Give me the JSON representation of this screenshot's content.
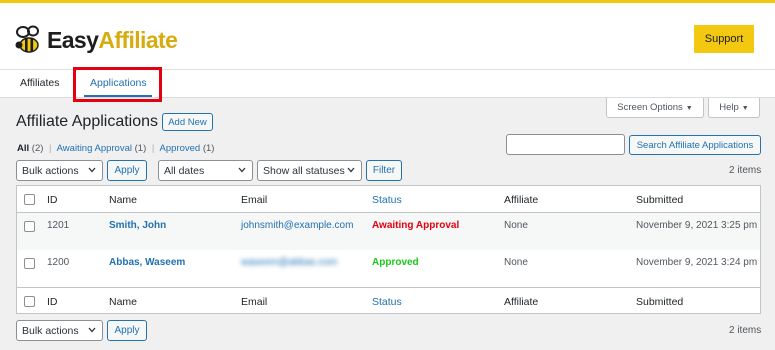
{
  "brand": {
    "logo_word1": "Easy",
    "logo_word2": "Affiliate",
    "support_label": "Support",
    "accent_color": "#f2c811"
  },
  "tabs": {
    "affiliates": "Affiliates",
    "applications": "Applications",
    "active": "applications"
  },
  "screen_options": {
    "screen_options_label": "Screen Options",
    "help_label": "Help"
  },
  "page": {
    "title": "Affiliate Applications",
    "add_new_label": "Add New"
  },
  "filters": {
    "all": {
      "label": "All",
      "count": "(2)"
    },
    "awaiting": {
      "label": "Awaiting Approval",
      "count": "(1)"
    },
    "approved": {
      "label": "Approved",
      "count": "(1)"
    },
    "separator": "|"
  },
  "search": {
    "value": "",
    "button_label": "Search Affiliate Applications"
  },
  "toolbar_top": {
    "bulk_actions": "Bulk actions",
    "apply_label": "Apply",
    "dates": "All dates",
    "statuses": "Show all statuses",
    "filter_label": "Filter",
    "items_count": "2 items"
  },
  "table": {
    "columns": {
      "id": "ID",
      "name": "Name",
      "email": "Email",
      "status": "Status",
      "affiliate": "Affiliate",
      "submitted": "Submitted"
    },
    "rows": [
      {
        "id": "1201",
        "name": "Smith, John",
        "email": "johnsmith@example.com",
        "status": "Awaiting Approval",
        "affiliate": "None",
        "submitted": "November 9, 2021 3:25 pm"
      },
      {
        "id": "1200",
        "name": "Abbas, Waseem",
        "email": "waseem@abbas.com",
        "status": "Approved",
        "affiliate": "None",
        "submitted": "November 9, 2021 3:24 pm"
      }
    ]
  },
  "toolbar_bottom": {
    "bulk_actions": "Bulk actions",
    "apply_label": "Apply",
    "items_count": "2 items"
  },
  "icons": {
    "logo": "bee-icon",
    "dropdown": "chevron-down-icon",
    "caret": "caret-down-icon"
  },
  "colors": {
    "link": "#2271b1",
    "status_awaiting": "#e3000f",
    "status_approved": "#1ec71e",
    "highlight": "#e3000f"
  }
}
